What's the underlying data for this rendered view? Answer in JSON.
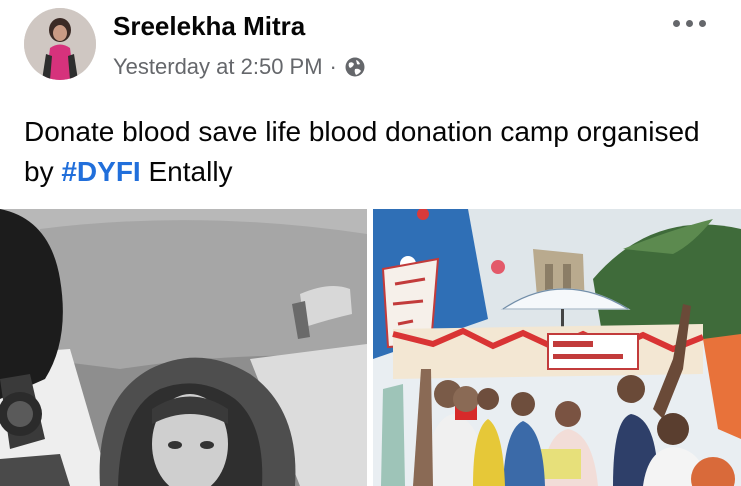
{
  "post": {
    "author": "Sreelekha Mitra",
    "timestamp": "Yesterday at 2:50 PM",
    "separator": "·",
    "privacy_icon": "globe-icon",
    "more_icon": "more-options-icon",
    "text_before": "Donate blood save life blood donation camp organised by ",
    "hashtag": "#DYFI",
    "text_after": " Entally",
    "hashtag_color": "#216fdb"
  },
  "photos": [
    {
      "name": "car-selfie-photo",
      "style": "black-and-white"
    },
    {
      "name": "blood-camp-photo",
      "style": "color"
    }
  ],
  "colors": {
    "name": "#050505",
    "meta": "#65676b",
    "link": "#216fdb"
  }
}
